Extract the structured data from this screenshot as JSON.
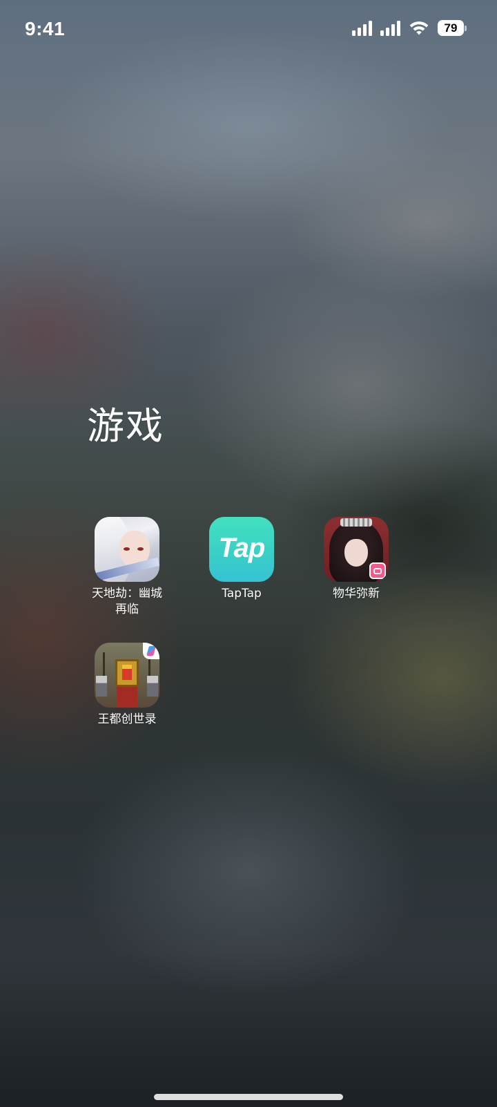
{
  "status_bar": {
    "time": "9:41",
    "battery_level": "79",
    "icons": [
      "cellular-signal-icon",
      "cellular-signal-icon",
      "wifi-icon",
      "battery-icon"
    ]
  },
  "folder": {
    "title": "游戏",
    "apps": [
      {
        "label": "天地劫：幽城\n再临",
        "icon": "tiandijie-app-icon"
      },
      {
        "label": "TapTap",
        "icon": "taptap-app-icon",
        "icon_text": "Tap"
      },
      {
        "label": "物华弥新",
        "icon": "wuhuamixin-app-icon"
      },
      {
        "label": "王都创世录",
        "icon": "wangduchuangshilu-app-icon"
      }
    ]
  },
  "colors": {
    "taptap_brand": "#3ad0c6",
    "badge_pink": "#f55a8a"
  }
}
